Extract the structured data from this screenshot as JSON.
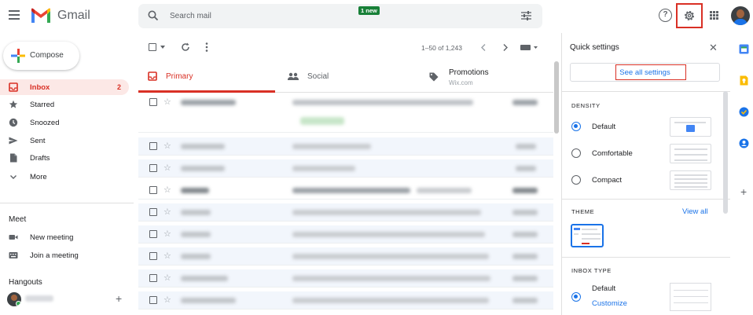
{
  "header": {
    "app_name": "Gmail",
    "search_placeholder": "Search mail",
    "help_symbol": "?"
  },
  "sidebar": {
    "compose_label": "Compose",
    "items": [
      {
        "label": "Inbox",
        "count": "2",
        "icon": "inbox-icon"
      },
      {
        "label": "Starred",
        "icon": "star-icon"
      },
      {
        "label": "Snoozed",
        "icon": "clock-icon"
      },
      {
        "label": "Sent",
        "icon": "send-icon"
      },
      {
        "label": "Drafts",
        "icon": "draft-icon"
      },
      {
        "label": "More",
        "icon": "chevron-down-icon"
      }
    ],
    "meet": {
      "title": "Meet",
      "items": [
        {
          "label": "New meeting",
          "icon": "video-icon"
        },
        {
          "label": "Join a meeting",
          "icon": "keyboard-icon"
        }
      ]
    },
    "hangouts": {
      "title": "Hangouts"
    }
  },
  "toolbar": {
    "pager": "1–50 of 1,243"
  },
  "tabs": [
    {
      "label": "Primary",
      "icon": "inbox-icon"
    },
    {
      "label": "Social",
      "icon": "people-icon"
    },
    {
      "label": "Promotions",
      "icon": "tag-icon",
      "badge": "1 new",
      "subtitle": "Wix.com"
    }
  ],
  "quick_settings": {
    "title": "Quick settings",
    "see_all": "See all settings",
    "density": {
      "heading": "DENSITY",
      "options": [
        "Default",
        "Comfortable",
        "Compact"
      ],
      "selected": "Default"
    },
    "theme": {
      "heading": "THEME",
      "view_all": "View all"
    },
    "inbox_type": {
      "heading": "INBOX TYPE",
      "option": "Default",
      "customize": "Customize"
    }
  },
  "colors": {
    "accent_red": "#d93025",
    "link_blue": "#1a73e8",
    "new_badge_green": "#188038"
  }
}
